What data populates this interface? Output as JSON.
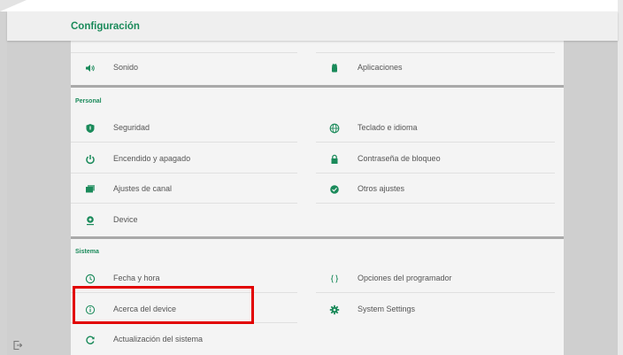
{
  "header": {
    "title": "Configuración"
  },
  "top_items": [
    {
      "label": "Sonido",
      "icon": "volume-icon"
    },
    {
      "label": "Aplicaciones",
      "icon": "android-icon"
    }
  ],
  "personal": {
    "title": "Personal",
    "left": [
      {
        "label": "Seguridad",
        "icon": "shield-icon"
      },
      {
        "label": "Encendido y apagado",
        "icon": "power-icon"
      },
      {
        "label": "Ajustes de canal",
        "icon": "channel-icon"
      },
      {
        "label": "Device",
        "icon": "location-pin-icon"
      }
    ],
    "right": [
      {
        "label": "Teclado e idioma",
        "icon": "globe-icon"
      },
      {
        "label": "Contraseña de bloqueo",
        "icon": "lock-icon"
      },
      {
        "label": "Otros ajustes",
        "icon": "check-circle-icon"
      }
    ]
  },
  "sistema": {
    "title": "Sistema",
    "left": [
      {
        "label": "Fecha y hora",
        "icon": "clock-icon"
      },
      {
        "label": "Acerca del device",
        "icon": "info-icon"
      },
      {
        "label": "Actualización del sistema",
        "icon": "refresh-icon"
      }
    ],
    "right": [
      {
        "label": "Opciones del programador",
        "icon": "braces-icon"
      },
      {
        "label": "System Settings",
        "icon": "gear-icon"
      }
    ]
  },
  "colors": {
    "accent": "#1a8a5a",
    "highlight": "#e20000"
  }
}
